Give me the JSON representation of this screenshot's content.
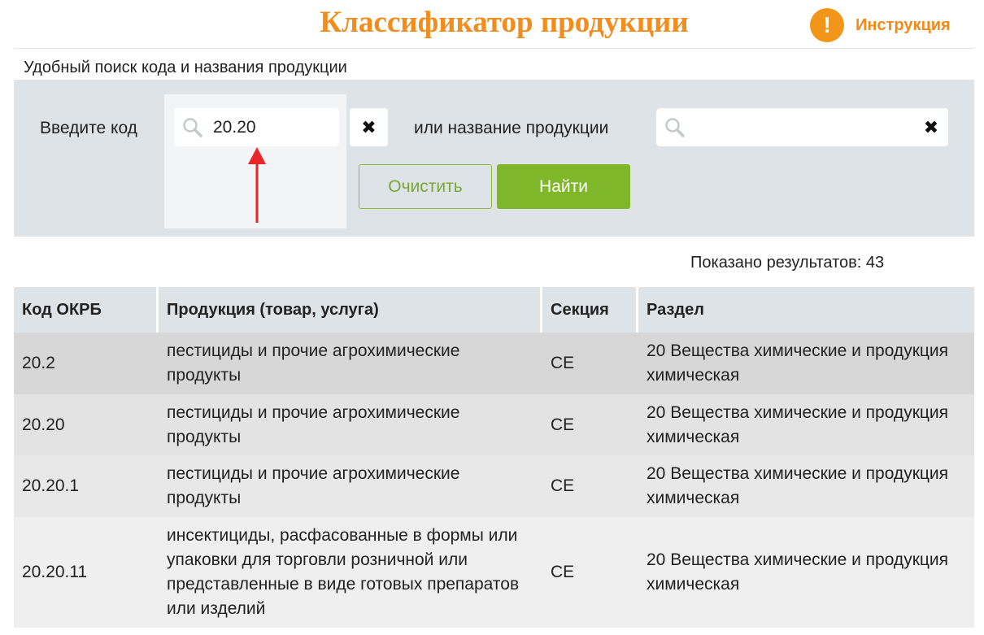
{
  "header": {
    "title": "Классификатор продукции",
    "help_icon": "exclamation-icon",
    "help_icon_glyph": "!",
    "help_label": "Инструкция"
  },
  "subtitle": "Удобный поиск кода и названия продукции",
  "search": {
    "code_label": "Введите код",
    "code_value": "20.20",
    "code_clear_glyph": "✖",
    "name_label": "или название продукции",
    "name_value": "",
    "name_clear_glyph": "✖",
    "clear_button": "Очистить",
    "find_button": "Найти"
  },
  "results_count": "Показано результатов: 43",
  "table": {
    "headers": [
      "Код ОКРБ",
      "Продукция (товар, услуга)",
      "Секция",
      "Раздел"
    ],
    "rows": [
      {
        "code": "20.2",
        "product": "пестициды и прочие агрохимические продукты",
        "section": "CE",
        "division": "20 Вещества химические и продукция химическая"
      },
      {
        "code": "20.20",
        "product": "пестициды и прочие агрохимические продукты",
        "section": "CE",
        "division": "20 Вещества химические и продукция химическая"
      },
      {
        "code": "20.20.1",
        "product": "пестициды и прочие агрохимические продукты",
        "section": "CE",
        "division": "20 Вещества химические и продукция химическая"
      },
      {
        "code": "20.20.11",
        "product": "инсектициды, расфасованные в формы или упаковки для торговли розничной или представленные в виде готовых препаратов или изделий",
        "section": "CE",
        "division": "20 Вещества химические и продукция химическая"
      }
    ]
  },
  "colors": {
    "accent_orange": "#f28c1c",
    "find_green": "#7eb729",
    "panel_gray": "#dde3e7",
    "annotation_red": "#e8262a"
  }
}
